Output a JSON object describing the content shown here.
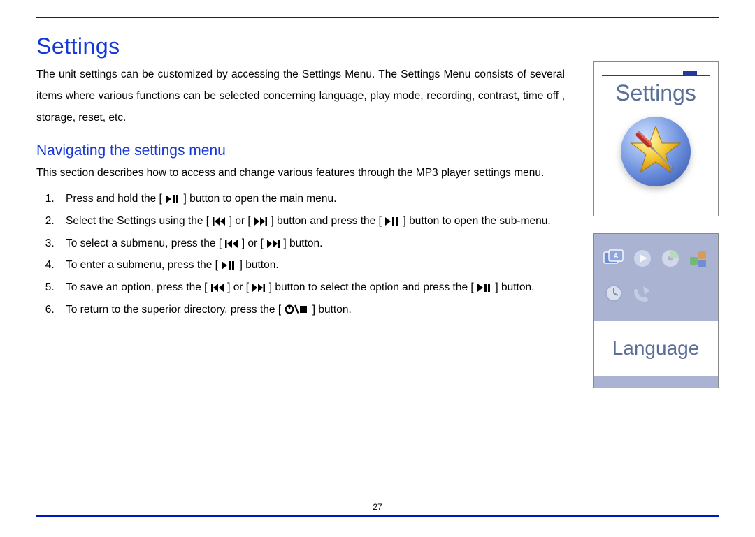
{
  "title": "Settings",
  "intro": "The unit settings can be customized by accessing the Settings Menu. The Settings Menu consists of several items where various functions can be selected concerning language, play mode, recording, contrast, time off , storage, reset, etc.",
  "subhead": "Navigating the settings menu",
  "subintro": "This section describes how to access and change various features through the MP3 player settings menu.",
  "steps": {
    "s1a": "Press and hold the [",
    "s1b": "] button to open the main menu.",
    "s2a": "Select the Settings using the [",
    "s2b": "] or [",
    "s2c": "] button and press the [",
    "s2d": "] button to open the sub-menu.",
    "s3a": "To select a submenu, press the [",
    "s3b": "] or [",
    "s3c": "] button.",
    "s4a": "To enter a submenu, press the [",
    "s4b": "] button.",
    "s5a": "To save an option, press the [",
    "s5b": "] or [",
    "s5c": "] button to select the option and press the [",
    "s5d": "] button.",
    "s6a": "To return to the superior directory, press the [",
    "s6b": "] button."
  },
  "page_number": "27",
  "screenshot1_label": "Settings",
  "screenshot2_label": "Language"
}
